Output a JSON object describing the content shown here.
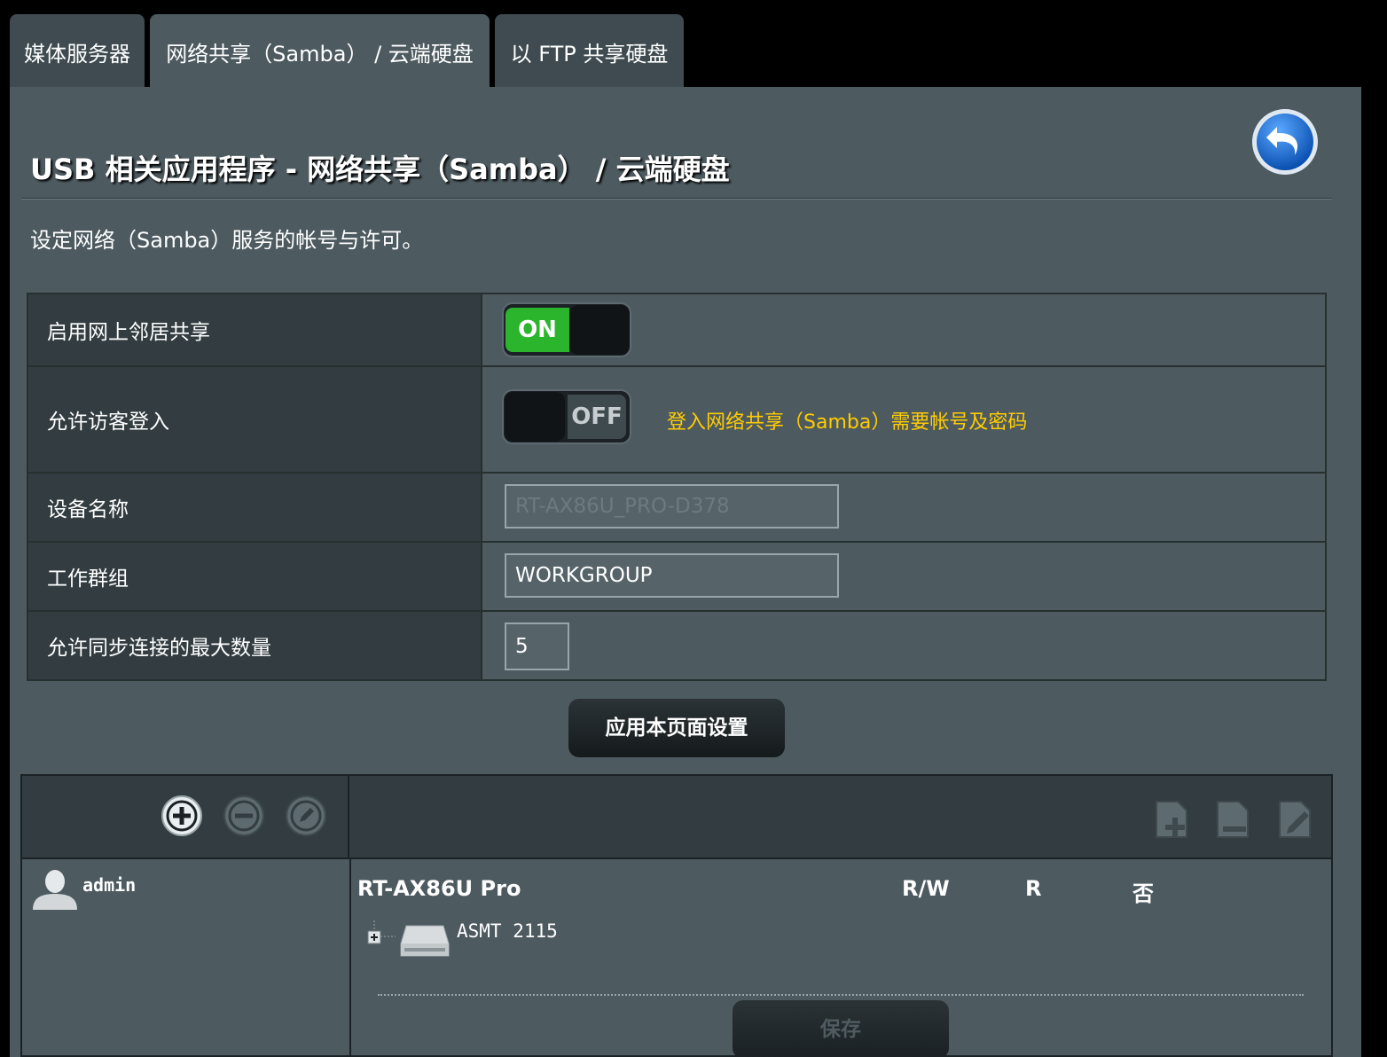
{
  "tabs": [
    {
      "label": "媒体服务器",
      "active": false
    },
    {
      "label": "网络共享（Samba） / 云端硬盘",
      "active": true
    },
    {
      "label": "以 FTP 共享硬盘",
      "active": false
    }
  ],
  "header": {
    "title": "USB 相关应用程序 - 网络共享（Samba） / 云端硬盘",
    "description": "设定网络（Samba）服务的帐号与许可。"
  },
  "settings": {
    "enable_sharing": {
      "label": "启用网上邻居共享",
      "toggle_text": "ON"
    },
    "guest_login": {
      "label": "允许访客登入",
      "toggle_text": "OFF",
      "hint": "登入网络共享（Samba）需要帐号及密码"
    },
    "device_name": {
      "label": "设备名称",
      "value": "RT-AX86U_PRO-D378"
    },
    "workgroup": {
      "label": "工作群组",
      "value": "WORKGROUP"
    },
    "max_connections": {
      "label": "允许同步连接的最大数量",
      "value": "5"
    }
  },
  "apply_button": "应用本页面设置",
  "accounts": {
    "user": "admin",
    "device": "RT-AX86U Pro",
    "permissions": {
      "rw": "R/W",
      "r": "R",
      "none": "否"
    },
    "folder": "ASMT 2115",
    "save_button": "保存"
  },
  "colors": {
    "accent_green": "#2bb52d",
    "hint_yellow": "#ffcc00",
    "panel_bg": "#4d5a60"
  }
}
